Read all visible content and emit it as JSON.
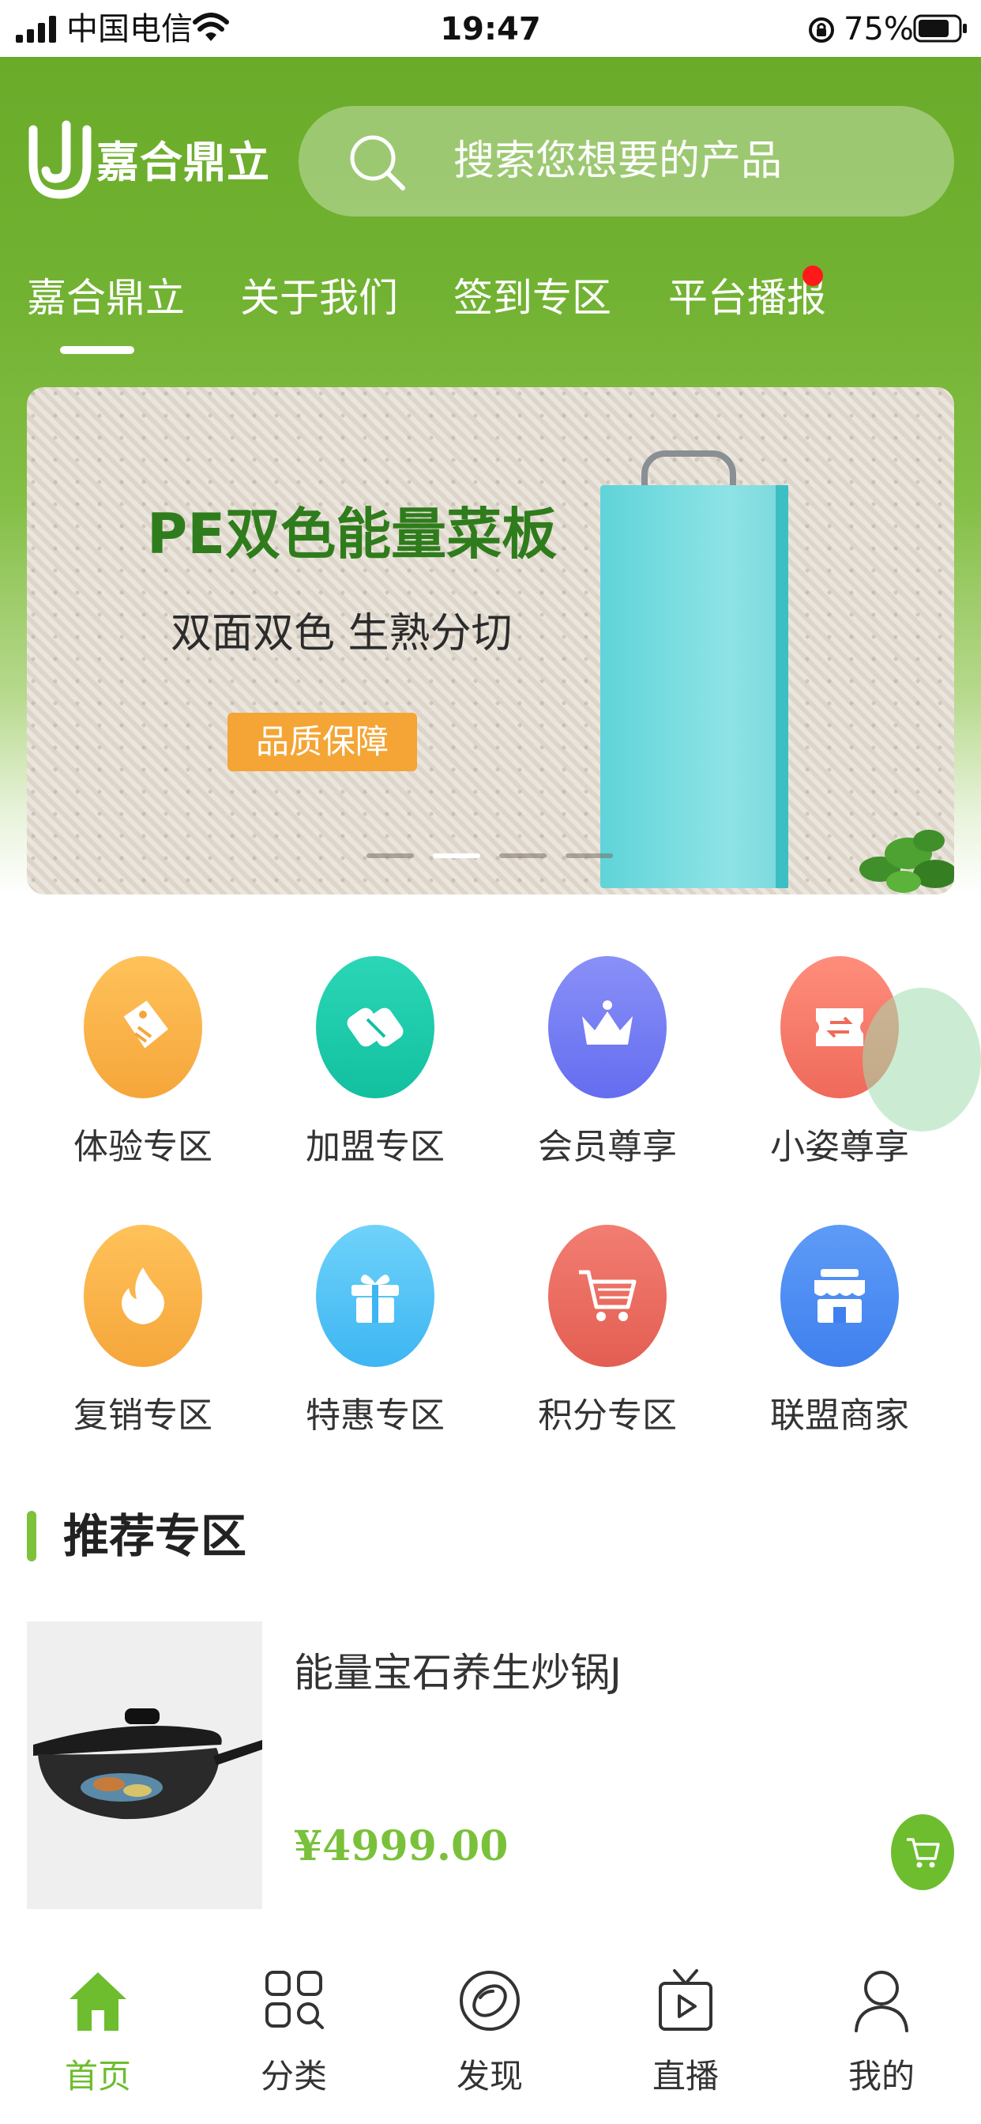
{
  "status_bar": {
    "carrier": "中国电信",
    "time": "19:47",
    "battery": "75%"
  },
  "header": {
    "logo_text": "嘉合鼎立",
    "search_placeholder": "搜索您想要的产品"
  },
  "tabs": [
    {
      "label": "嘉合鼎立",
      "active": true
    },
    {
      "label": "关于我们",
      "active": false
    },
    {
      "label": "签到专区",
      "active": false
    },
    {
      "label": "平台播报",
      "active": false,
      "badge": true
    }
  ],
  "banner": {
    "title": "PE双色能量菜板",
    "subtitle": "双面双色 生熟分切",
    "badge": "品质保障",
    "slides": 4,
    "active_slide": 2
  },
  "categories": [
    {
      "label": "体验专区",
      "icon": "tag-icon",
      "color": "#f8ac43"
    },
    {
      "label": "加盟专区",
      "icon": "franchise-icon",
      "color": "#1ccaa8"
    },
    {
      "label": "会员尊享",
      "icon": "crown-icon",
      "color": "#6f7bf2"
    },
    {
      "label": "小姿尊享",
      "icon": "ticket-exchange-icon",
      "color": "#f27a6a"
    },
    {
      "label": "复销专区",
      "icon": "flame-icon",
      "color": "#f8ac43"
    },
    {
      "label": "特惠专区",
      "icon": "gift-icon",
      "color": "#4fc3f5"
    },
    {
      "label": "积分专区",
      "icon": "shopping-cart-icon",
      "color": "#ea6a5e"
    },
    {
      "label": "联盟商家",
      "icon": "store-icon",
      "color": "#4b8ef2"
    }
  ],
  "section": {
    "title": "推荐专区"
  },
  "product": {
    "name": "能量宝石养生炒锅J",
    "price": "¥4999.00"
  },
  "tabbar": [
    {
      "label": "首页",
      "icon": "home-icon",
      "active": true
    },
    {
      "label": "分类",
      "icon": "category-grid-icon",
      "active": false
    },
    {
      "label": "发现",
      "icon": "discover-icon",
      "active": false
    },
    {
      "label": "直播",
      "icon": "live-tv-icon",
      "active": false
    },
    {
      "label": "我的",
      "icon": "profile-icon",
      "active": false
    }
  ],
  "colors": {
    "brand_green": "#6aab2a",
    "accent_green": "#7ac13b",
    "badge_orange": "#f4a535",
    "notify_red": "#ff1a1a"
  }
}
